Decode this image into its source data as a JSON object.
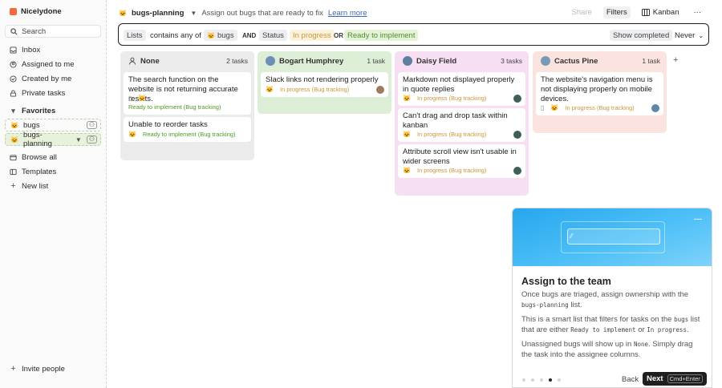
{
  "app": {
    "name": "Nicelydone"
  },
  "sidebar": {
    "search": "Search",
    "items": [
      {
        "label": "Inbox",
        "icon": "inbox-icon"
      },
      {
        "label": "Assigned to me",
        "icon": "assigned-icon"
      },
      {
        "label": "Created by me",
        "icon": "created-icon"
      },
      {
        "label": "Private tasks",
        "icon": "lock-icon"
      }
    ],
    "favorites_label": "Favorites",
    "favorites": [
      {
        "label": "bugs"
      },
      {
        "label": "bugs-planning"
      }
    ],
    "bottom": [
      {
        "label": "Browse all"
      },
      {
        "label": "Templates"
      },
      {
        "label": "New list"
      }
    ],
    "invite": "Invite people"
  },
  "header": {
    "title": "bugs-planning",
    "subtitle": "Assign out bugs that are ready to fix",
    "learn_more": "Learn more",
    "share": "Share",
    "filters": "Filters",
    "kanban": "Kanban",
    "more": "···"
  },
  "filterbar": {
    "lists": "Lists",
    "contains": "contains any of",
    "list_value": "bugs",
    "and": "AND",
    "status": "Status",
    "in_progress": "In progress",
    "or": "OR",
    "ready": "Ready to implement",
    "show_completed": "Show completed",
    "never": "Never"
  },
  "columns": [
    {
      "name": "None",
      "count": "2 tasks",
      "color": "#ebebeb",
      "cards": [
        {
          "title": "The search function on the website is not returning accurate results.",
          "tag": "Ready to implement (Bug tracking)"
        },
        {
          "title": "Unable to reorder tasks",
          "tag": "Ready to implement (Bug tracking)"
        }
      ]
    },
    {
      "name": "Bogart Humphrey",
      "count": "1 task",
      "color": "#dcefd6",
      "cards": [
        {
          "title": "Slack links not rendering properly",
          "tag": "In progress (Bug tracking)"
        }
      ]
    },
    {
      "name": "Daisy Field",
      "count": "3 tasks",
      "color": "#f6def3",
      "cards": [
        {
          "title": "Markdown not displayed properly in quote replies",
          "tag": "In progress (Bug tracking)"
        },
        {
          "title": "Can't drag and drop task within kanban",
          "tag": "In progress (Bug tracking)"
        },
        {
          "title": "Attribute scroll view isn't usable in wider screens",
          "tag": "In progress (Bug tracking)"
        }
      ]
    },
    {
      "name": "Cactus Pine",
      "count": "1 task",
      "color": "#fbe3e0",
      "cards": [
        {
          "title": "The website's navigation menu is not displaying properly on mobile devices.",
          "tag": "In progress (Bug tracking)"
        }
      ]
    }
  ],
  "tour": {
    "title": "Assign to the team",
    "p1_a": "Once bugs are triaged, assign ownership with the",
    "p1_code": "bugs-planning",
    "p1_b": "list.",
    "p2_a": "This is a smart list that filters for tasks on the",
    "p2_code1": "bugs",
    "p2_b": "list that are either",
    "p2_code2": "Ready to implement",
    "p2_c": "or",
    "p2_code3": "In progress",
    "p2_d": ".",
    "p3_a": "Unassigned bugs will show up in",
    "p3_code": "None",
    "p3_b": ". Simply drag the task into the assignee columns.",
    "back": "Back",
    "next": "Next",
    "shortcut": "Cmd+Enter"
  }
}
